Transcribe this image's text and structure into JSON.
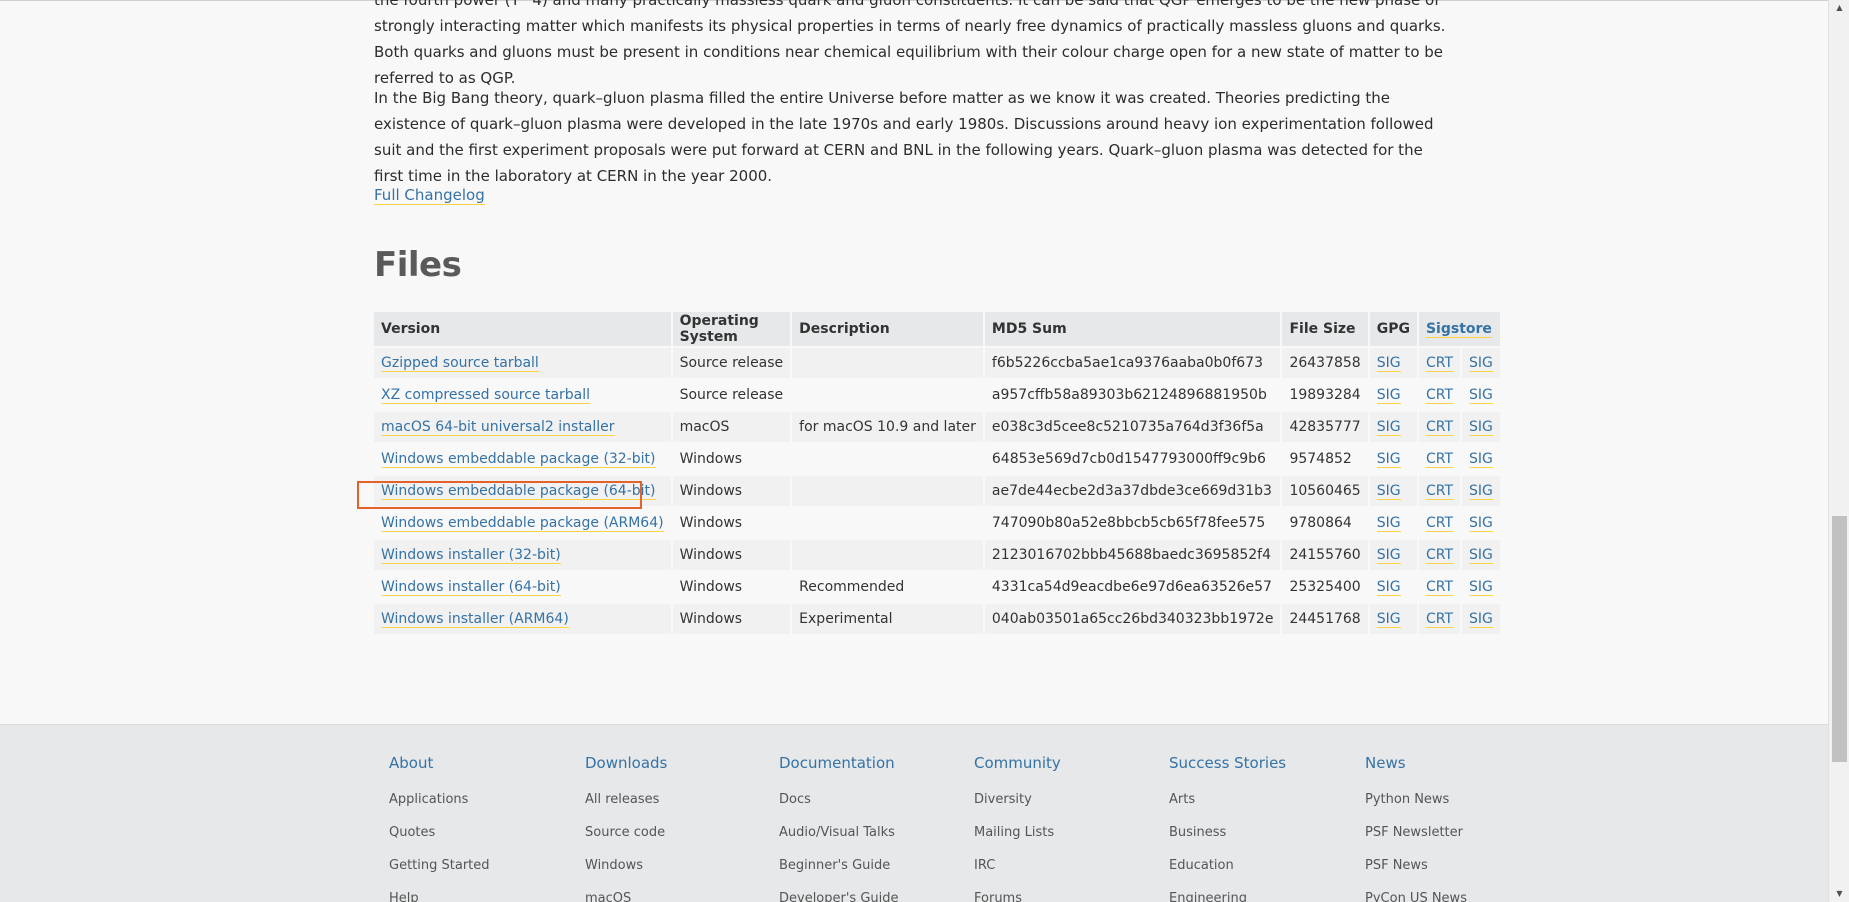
{
  "article": {
    "para0": "the fourth power (T^4) and many practically massless quark and gluon constituents. It can be said that QGP emerges to be the new phase of strongly interacting matter which manifests its physical properties in terms of nearly free dynamics of practically massless gluons and quarks. Both quarks and gluons must be present in conditions near chemical equilibrium with their colour charge open for a new state of matter to be referred to as QGP.",
    "para1": "In the Big Bang theory, quark–gluon plasma filled the entire Universe before matter as we know it was created. Theories predicting the existence of quark–gluon plasma were developed in the late 1970s and early 1980s. Discussions around heavy ion experimentation followed suit and the first experiment proposals were put forward at CERN and BNL in the following years. Quark–gluon plasma was detected for the first time in the laboratory at CERN in the year 2000.",
    "changelog_link": "Full Changelog"
  },
  "files": {
    "title": "Files",
    "headers": {
      "version": "Version",
      "os": "Operating System",
      "description": "Description",
      "md5": "MD5 Sum",
      "size": "File Size",
      "gpg": "GPG",
      "sigstore": "Sigstore"
    },
    "rows": [
      {
        "version": "Gzipped source tarball",
        "os": "Source release",
        "description": "",
        "md5": "f6b5226ccba5ae1ca9376aaba0b0f673",
        "size": "26437858",
        "gpg": "SIG",
        "crt": "CRT",
        "sig": "SIG"
      },
      {
        "version": "XZ compressed source tarball",
        "os": "Source release",
        "description": "",
        "md5": "a957cffb58a89303b62124896881950b",
        "size": "19893284",
        "gpg": "SIG",
        "crt": "CRT",
        "sig": "SIG"
      },
      {
        "version": "macOS 64-bit universal2 installer",
        "os": "macOS",
        "description": "for macOS 10.9 and later",
        "md5": "e038c3d5cee8c5210735a764d3f36f5a",
        "size": "42835777",
        "gpg": "SIG",
        "crt": "CRT",
        "sig": "SIG"
      },
      {
        "version": "Windows embeddable package (32-bit)",
        "os": "Windows",
        "description": "",
        "md5": "64853e569d7cb0d1547793000ff9c9b6",
        "size": "9574852",
        "gpg": "SIG",
        "crt": "CRT",
        "sig": "SIG"
      },
      {
        "version": "Windows embeddable package (64-bit)",
        "os": "Windows",
        "description": "",
        "md5": "ae7de44ecbe2d3a37dbde3ce669d31b3",
        "size": "10560465",
        "gpg": "SIG",
        "crt": "CRT",
        "sig": "SIG"
      },
      {
        "version": "Windows embeddable package (ARM64)",
        "os": "Windows",
        "description": "",
        "md5": "747090b80a52e8bbcb5cb65f78fee575",
        "size": "9780864",
        "gpg": "SIG",
        "crt": "CRT",
        "sig": "SIG"
      },
      {
        "version": "Windows installer (32-bit)",
        "os": "Windows",
        "description": "",
        "md5": "2123016702bbb45688baedc3695852f4",
        "size": "24155760",
        "gpg": "SIG",
        "crt": "CRT",
        "sig": "SIG"
      },
      {
        "version": "Windows installer (64-bit)",
        "os": "Windows",
        "description": "Recommended",
        "md5": "4331ca54d9eacdbe6e97d6ea63526e57",
        "size": "25325400",
        "gpg": "SIG",
        "crt": "CRT",
        "sig": "SIG"
      },
      {
        "version": "Windows installer (ARM64)",
        "os": "Windows",
        "description": "Experimental",
        "md5": "040ab03501a65cc26bd340323bb1972e",
        "size": "24451768",
        "gpg": "SIG",
        "crt": "CRT",
        "sig": "SIG"
      }
    ]
  },
  "footer": {
    "columns": [
      {
        "title": "About",
        "items": [
          "Applications",
          "Quotes",
          "Getting Started",
          "Help"
        ]
      },
      {
        "title": "Downloads",
        "items": [
          "All releases",
          "Source code",
          "Windows",
          "macOS"
        ]
      },
      {
        "title": "Documentation",
        "items": [
          "Docs",
          "Audio/Visual Talks",
          "Beginner's Guide",
          "Developer's Guide"
        ]
      },
      {
        "title": "Community",
        "items": [
          "Diversity",
          "Mailing Lists",
          "IRC",
          "Forums"
        ]
      },
      {
        "title": "Success Stories",
        "items": [
          "Arts",
          "Business",
          "Education",
          "Engineering"
        ]
      },
      {
        "title": "News",
        "items": [
          "Python News",
          "PSF Newsletter",
          "PSF News",
          "PyCon US News"
        ]
      }
    ]
  },
  "colors": {
    "link": "#3572a5",
    "underline": "#ffd343",
    "highlight_box": "#e2622a",
    "footer_bg": "#e6e8ea"
  }
}
